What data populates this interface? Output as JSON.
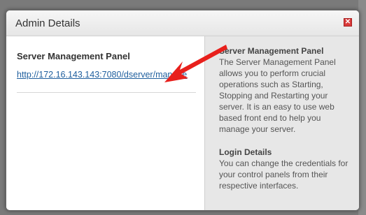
{
  "modal": {
    "title": "Admin Details",
    "close_symbol": "✕"
  },
  "left": {
    "heading": "Server Management Panel",
    "link": "http://172.16.143.143:7080/dserver/manage"
  },
  "right": {
    "section1_heading": "Server Management Panel",
    "section1_body": "The Server Management Panel allows you to perform crucial operations such as Starting, Stopping and Restarting your server. It is an easy to use web based front end to help you manage your server.",
    "section2_heading": "Login Details",
    "section2_body": "You can change the credentials for your control panels from their respective interfaces."
  },
  "annotation": {
    "arrow_color": "#e8201c",
    "icon": "pointer-arrow-icon"
  },
  "colors": {
    "link": "#1f5f9e",
    "close_button": "#d93a3a",
    "info_panel_bg": "#e7e7e7"
  }
}
